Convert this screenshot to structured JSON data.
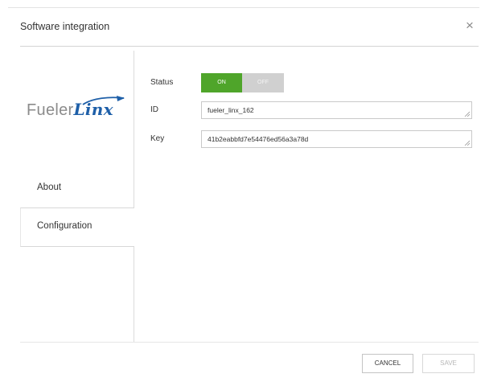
{
  "dialog": {
    "title": "Software integration",
    "close_glyph": "×"
  },
  "logo": {
    "text_a": "Fueler",
    "text_b": "Linx"
  },
  "nav": {
    "items": [
      {
        "label": "About",
        "active": false
      },
      {
        "label": "Configuration",
        "active": true
      }
    ]
  },
  "form": {
    "status_label": "Status",
    "toggle_on": "ON",
    "toggle_off": "OFF",
    "status_value": "ON",
    "id_label": "ID",
    "id_value": "fueler_linx_162",
    "key_label": "Key",
    "key_value": "41b2eabbfd7e54476ed56a3a78d"
  },
  "footer": {
    "cancel_label": "CANCEL",
    "save_label": "SAVE"
  },
  "colors": {
    "toggle_on": "#4fa52a",
    "toggle_off": "#d0d0d0",
    "brand_blue": "#1e5fa8"
  },
  "icons": {
    "close": "close-icon",
    "logo": "fuelerlinx-logo",
    "resize": "resize-grip-icon"
  }
}
